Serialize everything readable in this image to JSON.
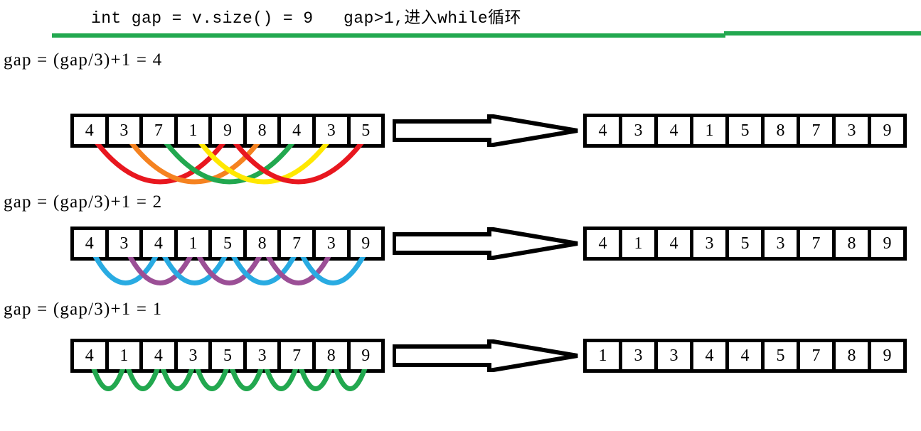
{
  "header": {
    "text": "int gap = v.size() = 9   gap>1,进入while循环"
  },
  "divider": {
    "color": "#22A84F"
  },
  "colors": {
    "red": "#E8171F",
    "orange": "#F58220",
    "green": "#22A84F",
    "yellow": "#FFE800",
    "blue": "#29ABE2",
    "purple": "#9B4F96",
    "box": "#000000",
    "background": "#FFFFFF"
  },
  "rows": [
    {
      "gap_label": "gap = (gap/3)+1 = 4",
      "gap_value": 4,
      "input": [
        "4",
        "3",
        "7",
        "1",
        "9",
        "8",
        "4",
        "3",
        "5"
      ],
      "output": [
        "4",
        "3",
        "4",
        "1",
        "5",
        "8",
        "7",
        "3",
        "9"
      ],
      "curve_colors": [
        "#E8171F",
        "#F58220",
        "#22A84F",
        "#FFE800",
        "#E8171F"
      ],
      "pairs": [
        {
          "from": 0,
          "to": 4,
          "color": "#E8171F"
        },
        {
          "from": 1,
          "to": 5,
          "color": "#F58220"
        },
        {
          "from": 2,
          "to": 6,
          "color": "#22A84F"
        },
        {
          "from": 3,
          "to": 7,
          "color": "#FFE800"
        },
        {
          "from": 4,
          "to": 8,
          "color": "#E8171F"
        }
      ]
    },
    {
      "gap_label": "gap = (gap/3)+1 = 2",
      "gap_value": 2,
      "input": [
        "4",
        "3",
        "4",
        "1",
        "5",
        "8",
        "7",
        "3",
        "9"
      ],
      "output": [
        "4",
        "1",
        "4",
        "3",
        "5",
        "3",
        "7",
        "8",
        "9"
      ],
      "curve_colors": [
        "#29ABE2",
        "#9B4F96"
      ],
      "pairs": [
        {
          "from": 0,
          "to": 2,
          "color": "#29ABE2"
        },
        {
          "from": 1,
          "to": 3,
          "color": "#9B4F96"
        },
        {
          "from": 2,
          "to": 4,
          "color": "#29ABE2"
        },
        {
          "from": 3,
          "to": 5,
          "color": "#9B4F96"
        },
        {
          "from": 4,
          "to": 6,
          "color": "#29ABE2"
        },
        {
          "from": 5,
          "to": 7,
          "color": "#9B4F96"
        },
        {
          "from": 6,
          "to": 8,
          "color": "#29ABE2"
        }
      ]
    },
    {
      "gap_label": "gap = (gap/3)+1 = 1",
      "gap_value": 1,
      "input": [
        "4",
        "1",
        "4",
        "3",
        "5",
        "3",
        "7",
        "8",
        "9"
      ],
      "output": [
        "1",
        "3",
        "3",
        "4",
        "4",
        "5",
        "7",
        "8",
        "9"
      ],
      "curve_colors": [
        "#22A84F"
      ],
      "pairs": [
        {
          "from": 0,
          "to": 1,
          "color": "#22A84F"
        },
        {
          "from": 1,
          "to": 2,
          "color": "#22A84F"
        },
        {
          "from": 2,
          "to": 3,
          "color": "#22A84F"
        },
        {
          "from": 3,
          "to": 4,
          "color": "#22A84F"
        },
        {
          "from": 4,
          "to": 5,
          "color": "#22A84F"
        },
        {
          "from": 5,
          "to": 6,
          "color": "#22A84F"
        },
        {
          "from": 6,
          "to": 7,
          "color": "#22A84F"
        },
        {
          "from": 7,
          "to": 8,
          "color": "#22A84F"
        }
      ]
    }
  ],
  "arrow": {
    "label": "transforms-to-arrow"
  }
}
